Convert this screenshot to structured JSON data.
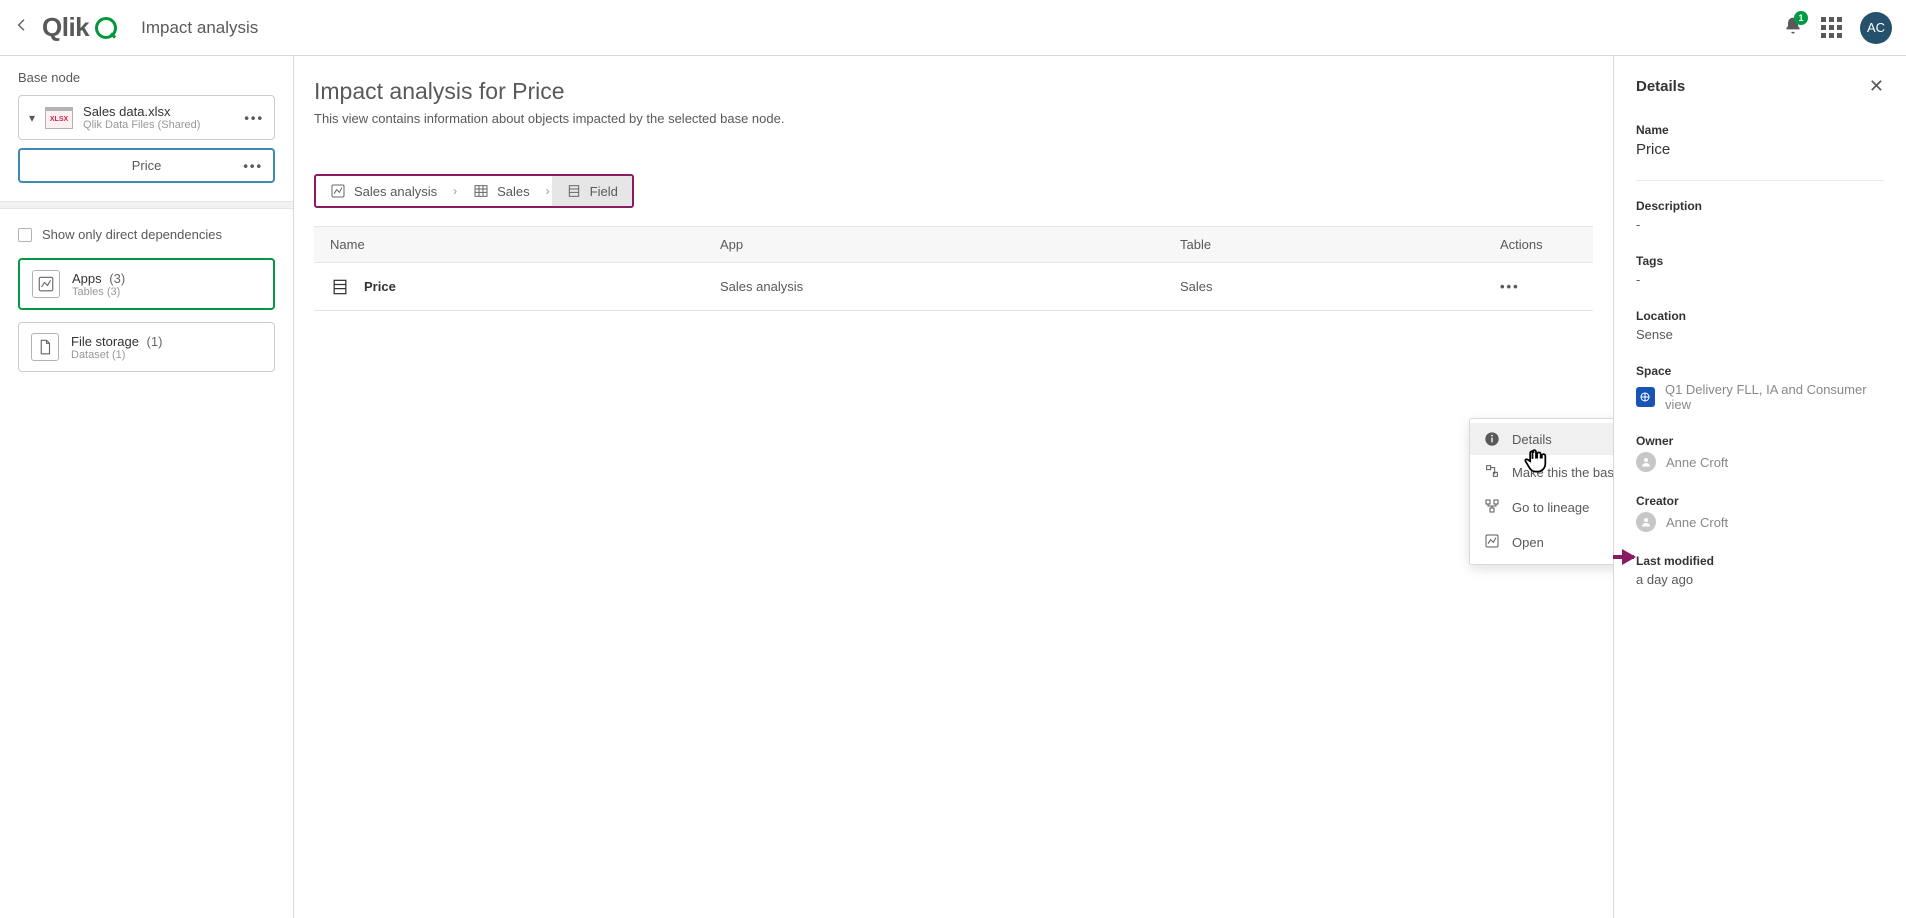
{
  "header": {
    "page_title": "Impact analysis",
    "notification_count": "1",
    "avatar_initials": "AC"
  },
  "sidebar": {
    "section_label": "Base node",
    "base_file": {
      "name": "Sales data.xlsx",
      "meta": "Qlik Data Files (Shared)"
    },
    "selected_field": "Price",
    "show_only_direct": "Show only direct dependencies",
    "filters": [
      {
        "title": "Apps",
        "count": "(3)",
        "subtitle": "Tables (3)"
      },
      {
        "title": "File storage",
        "count": "(1)",
        "subtitle": "Dataset (1)"
      }
    ]
  },
  "main": {
    "heading": "Impact analysis for Price",
    "subtitle": "This view contains information about objects impacted by the selected base node.",
    "breadcrumb": [
      {
        "label": "Sales analysis"
      },
      {
        "label": "Sales"
      },
      {
        "label": "Field"
      }
    ],
    "columns": {
      "name": "Name",
      "app": "App",
      "table": "Table",
      "actions": "Actions"
    },
    "rows": [
      {
        "name": "Price",
        "app": "Sales analysis",
        "table": "Sales"
      }
    ]
  },
  "context_menu": {
    "details": "Details",
    "make_base": "Make this the base node",
    "lineage": "Go to lineage",
    "open": "Open"
  },
  "details": {
    "title": "Details",
    "name_label": "Name",
    "name_value": "Price",
    "description_label": "Description",
    "description_value": "-",
    "tags_label": "Tags",
    "tags_value": "-",
    "location_label": "Location",
    "location_value": "Sense",
    "space_label": "Space",
    "space_value": "Q1 Delivery FLL, IA and Consumer view",
    "owner_label": "Owner",
    "owner_value": "Anne Croft",
    "creator_label": "Creator",
    "creator_value": "Anne Croft",
    "modified_label": "Last modified",
    "modified_value": "a day ago"
  }
}
